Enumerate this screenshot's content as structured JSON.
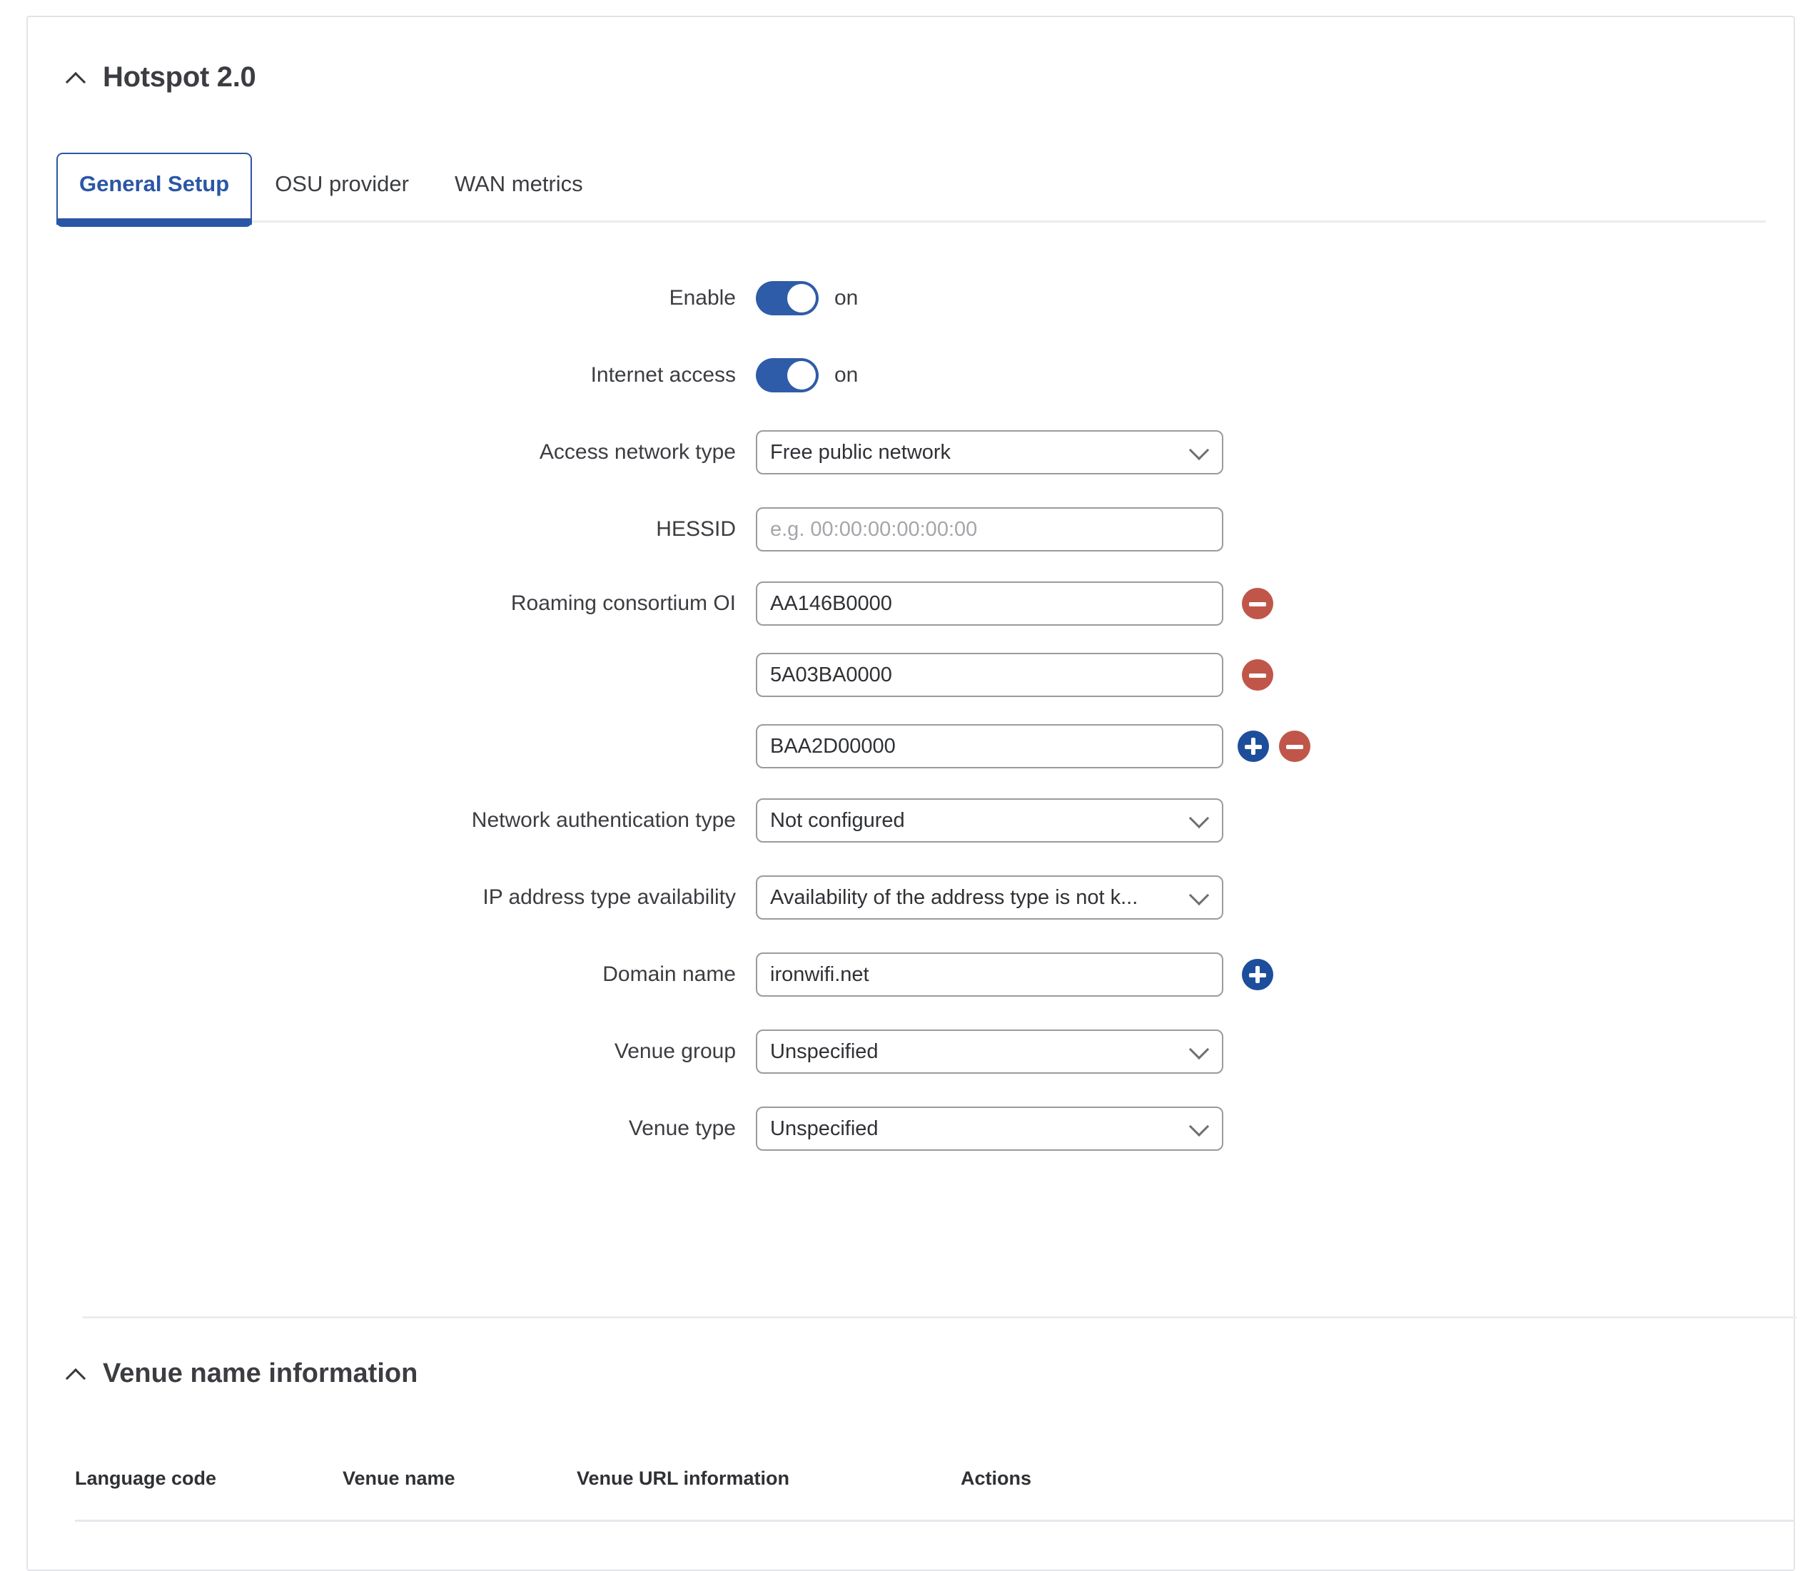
{
  "section": {
    "title": "Hotspot 2.0",
    "collapse_icon": "chevron-up-icon"
  },
  "tabs": [
    {
      "label": "General Setup",
      "active": true
    },
    {
      "label": "OSU provider",
      "active": false
    },
    {
      "label": "WAN metrics",
      "active": false
    }
  ],
  "form": {
    "enable": {
      "label": "Enable",
      "state": "on"
    },
    "internet_access": {
      "label": "Internet access",
      "state": "on"
    },
    "access_network_type": {
      "label": "Access network type",
      "value": "Free public network"
    },
    "hessid": {
      "label": "HESSID",
      "value": "",
      "placeholder": "e.g. 00:00:00:00:00:00"
    },
    "roaming_consortium_oi": {
      "label": "Roaming consortium OI",
      "values": [
        "AA146B0000",
        "5A03BA0000",
        "BAA2D00000"
      ],
      "remove_label": "−",
      "add_label": "+"
    },
    "network_authentication_type": {
      "label": "Network authentication type",
      "value": "Not configured"
    },
    "ip_address_type_availability": {
      "label": "IP address type availability",
      "value": "Availability of the address type is not k..."
    },
    "domain_name": {
      "label": "Domain name",
      "value": "ironwifi.net"
    },
    "venue_group": {
      "label": "Venue group",
      "value": "Unspecified"
    },
    "venue_type": {
      "label": "Venue type",
      "value": "Unspecified"
    }
  },
  "venue_section": {
    "title": "Venue name information",
    "collapse_icon": "chevron-up-icon",
    "table": {
      "columns": [
        "Language code",
        "Venue name",
        "Venue URL information",
        "Actions"
      ],
      "rows": []
    }
  },
  "colors": {
    "accent_blue": "#2b56a5",
    "toggle_blue": "#2f5ca8",
    "plus_blue": "#1d4e9c",
    "minus_red": "#c0564a",
    "text": "#3b3d41",
    "border": "#9a9ba0",
    "card_border": "#e3e4e8",
    "divider": "#ebecef"
  }
}
